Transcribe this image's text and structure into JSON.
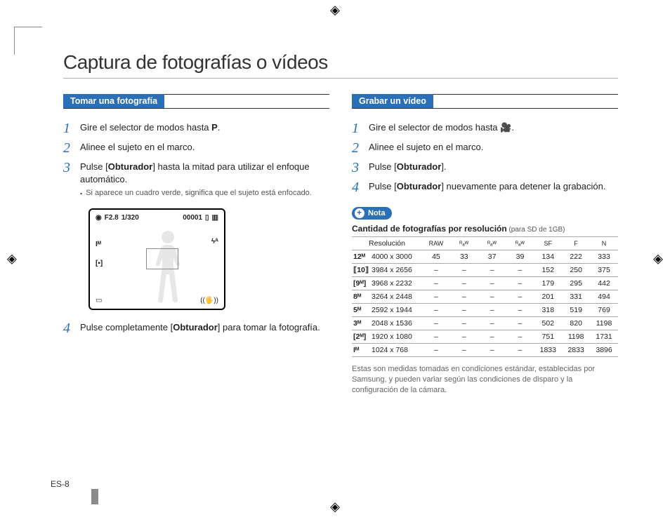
{
  "title": "Captura de fotografías o vídeos",
  "left": {
    "heading": "Tomar una fotografía",
    "steps": {
      "s1_pre": "Gire el selector de modos hasta ",
      "s1_mode": "P",
      "s1_post": ".",
      "s2": "Alinee el sujeto en el marco.",
      "s3_pre": "Pulse [",
      "s3_btn": "Obturador",
      "s3_post": "] hasta la mitad para utilizar el enfoque automático.",
      "s3_sub": "Si aparece un cuadro verde, significa que el sujeto está enfocado.",
      "s4_pre": "Pulse completamente [",
      "s4_btn": "Obturador",
      "s4_post": "] para tomar la fotografía."
    },
    "lcd": {
      "aperture": "F2.8",
      "shutter": "1/320",
      "counter": "00001",
      "flash": "ϟᴬ",
      "size_icon": "Iᴹ",
      "qual_icon": "[▪]",
      "drive_icon": "▭",
      "stab_icon": "((🖐))"
    }
  },
  "right": {
    "heading": "Grabar un vídeo",
    "steps": {
      "s1_pre": "Gire el selector de modos hasta ",
      "s1_icon": "🎥",
      "s1_post": ".",
      "s2": "Alinee el sujeto en el marco.",
      "s3_pre": "Pulse [",
      "s3_btn": "Obturador",
      "s3_post": "].",
      "s4_pre": "Pulse [",
      "s4_btn": "Obturador",
      "s4_post": "] nuevamente para detener la grabación."
    },
    "note_label": "Nota",
    "note_caption_bold": "Cantidad de fotografías por resolución",
    "note_caption_small": " (para SD de 1GB)",
    "table": {
      "head_res": "Resolución",
      "cols": [
        "RAW",
        "ᴿₐᵂ",
        "ᴿₐᵂ",
        "ᴿₐᵂ",
        "SF",
        "F",
        "N"
      ],
      "rows": [
        {
          "icon": "12ᴹ",
          "res": "4000 x 3000",
          "v": [
            "45",
            "33",
            "37",
            "39",
            "134",
            "222",
            "333"
          ]
        },
        {
          "icon": "⟦10⟧",
          "res": "3984 x 2656",
          "v": [
            "–",
            "–",
            "–",
            "–",
            "152",
            "250",
            "375"
          ]
        },
        {
          "icon": "[9ᴹ]",
          "res": "3968 x 2232",
          "v": [
            "–",
            "–",
            "–",
            "–",
            "179",
            "295",
            "442"
          ]
        },
        {
          "icon": "8ᴹ",
          "res": "3264 x 2448",
          "v": [
            "–",
            "–",
            "–",
            "–",
            "201",
            "331",
            "494"
          ]
        },
        {
          "icon": "5ᴹ",
          "res": "2592 x 1944",
          "v": [
            "–",
            "–",
            "–",
            "–",
            "318",
            "519",
            "769"
          ]
        },
        {
          "icon": "3ᴹ",
          "res": "2048 x 1536",
          "v": [
            "–",
            "–",
            "–",
            "–",
            "502",
            "820",
            "1198"
          ]
        },
        {
          "icon": "[2ᴹ]",
          "res": "1920 x 1080",
          "v": [
            "–",
            "–",
            "–",
            "–",
            "751",
            "1198",
            "1731"
          ]
        },
        {
          "icon": "Iᴹ",
          "res": "1024 x 768",
          "v": [
            "–",
            "–",
            "–",
            "–",
            "1833",
            "2833",
            "3896"
          ]
        }
      ]
    },
    "footnote": "Estas son medidas tomadas en condiciones estándar, establecidas por Samsung, y pueden variar según las condiciones de disparo y la configuración de la cámara."
  },
  "page_number": "ES-8"
}
